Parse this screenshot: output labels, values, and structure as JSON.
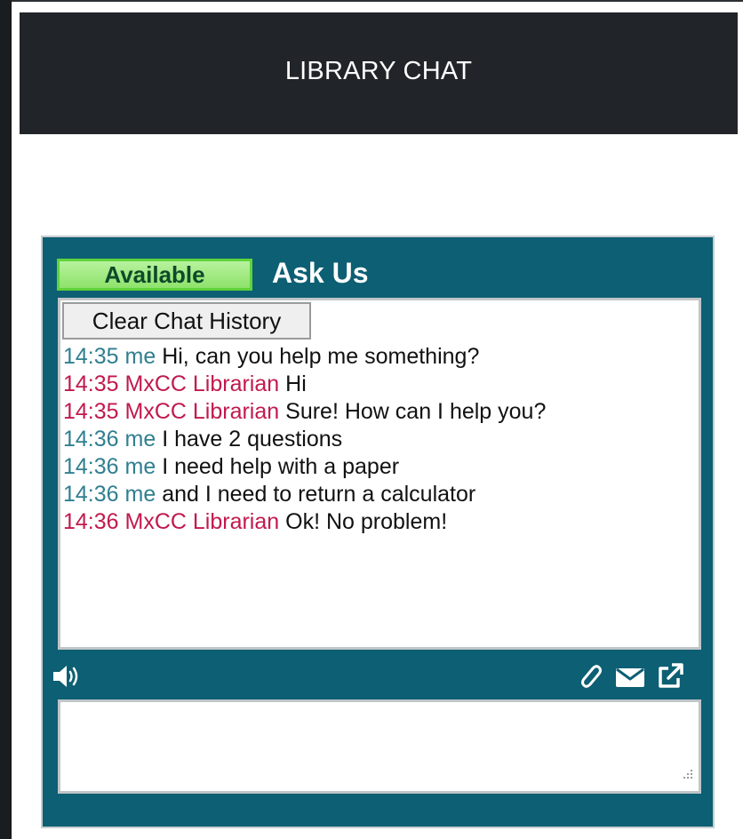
{
  "header": {
    "title": "LIBRARY CHAT"
  },
  "widget": {
    "status": "Available",
    "title": "Ask Us",
    "clear_button": "Clear Chat History",
    "colors": {
      "panel": "#0d5f73",
      "me": "#2f7f8f",
      "librarian": "#c2194d",
      "available": "#8ee26b"
    },
    "messages": [
      {
        "time": "14:35",
        "sender": "me",
        "text": "Hi, can you help me something?"
      },
      {
        "time": "14:35",
        "sender": "MxCC Librarian",
        "text": "Hi"
      },
      {
        "time": "14:35",
        "sender": "MxCC Librarian",
        "text": "Sure! How can I help you?"
      },
      {
        "time": "14:36",
        "sender": "me",
        "text": "I have 2 questions"
      },
      {
        "time": "14:36",
        "sender": "me",
        "text": "I need help with a paper"
      },
      {
        "time": "14:36",
        "sender": "me",
        "text": "and I need to return a calculator"
      },
      {
        "time": "14:36",
        "sender": "MxCC Librarian",
        "text": "Ok! No problem!"
      }
    ],
    "toolbar_icons": [
      "sound-icon",
      "paperclip-icon",
      "mail-icon",
      "popout-icon"
    ],
    "compose_value": ""
  }
}
